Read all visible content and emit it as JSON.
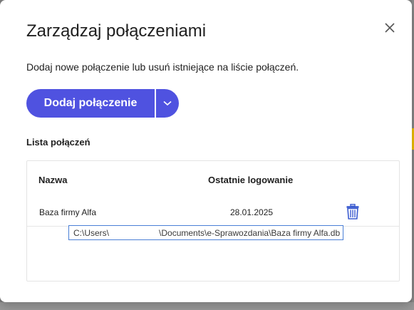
{
  "dialog": {
    "title": "Zarządzaj połączeniami",
    "description": "Dodaj nowe połączenie lub usuń istniejące na liście połączeń.",
    "close_icon": "close-icon"
  },
  "actions": {
    "add_label": "Dodaj połączenie",
    "dropdown_icon": "chevron-down-icon",
    "accent": "#4f52e0"
  },
  "list": {
    "title": "Lista połączeń",
    "columns": [
      "Nazwa",
      "Ostatnie logowanie"
    ],
    "rows": [
      {
        "name": "Baza firmy Alfa",
        "last_login": "28.01.2025",
        "delete_icon": "trash-icon"
      }
    ]
  },
  "tooltip": {
    "path_start": "C:\\Users\\",
    "path_end": "\\Documents\\e-Sprawozdania\\Baza firmy Alfa.db"
  }
}
